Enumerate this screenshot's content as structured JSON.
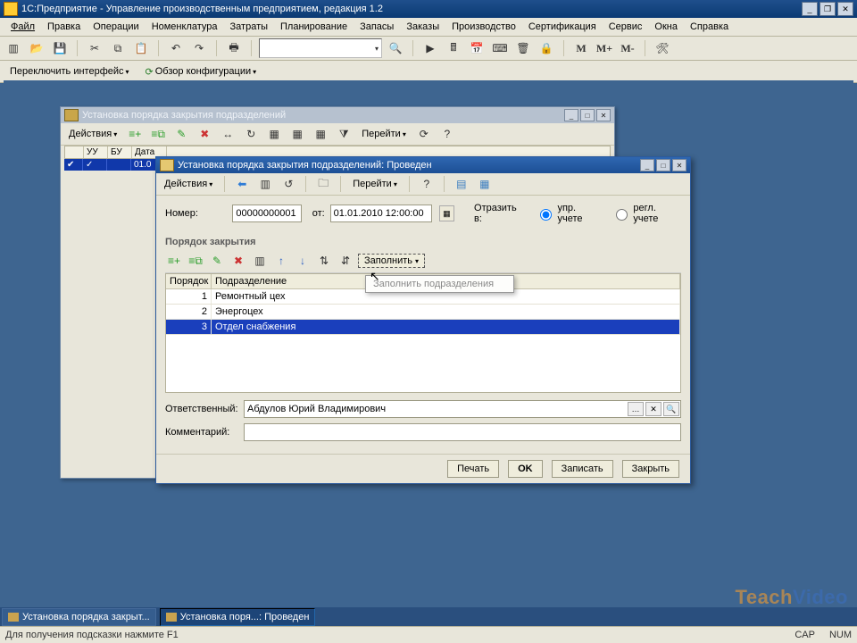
{
  "app": {
    "title": "1С:Предприятие - Управление производственным предприятием, редакция 1.2"
  },
  "menu": [
    "Файл",
    "Правка",
    "Операции",
    "Номенклатура",
    "Затраты",
    "Планирование",
    "Запасы",
    "Заказы",
    "Производство",
    "Сертификация",
    "Сервис",
    "Окна",
    "Справка"
  ],
  "subtoolbar": {
    "switch_iface": "Переключить интерфейс",
    "config_overview": "Обзор конфигурации"
  },
  "toolbar_letters": {
    "m": "M",
    "mp": "M+",
    "mm": "M-"
  },
  "bg_window": {
    "title": "Установка порядка закрытия подразделений",
    "actions": "Действия",
    "go": "Перейти",
    "headers": {
      "uu": "УУ",
      "bu": "БУ",
      "date": "Дата"
    },
    "row_date": "01.0"
  },
  "modal": {
    "title": "Установка порядка закрытия подразделений: Проведен",
    "actions": "Действия",
    "go": "Перейти",
    "number_label": "Номер:",
    "number_value": "00000000001",
    "from_label": "от:",
    "date_value": "01.01.2010 12:00:00",
    "reflect_label": "Отразить в:",
    "radio_mgmt": "упр. учете",
    "radio_reg": "регл. учете",
    "section": "Порядок закрытия",
    "fill_btn": "Заполнить",
    "menu_fill_depts": "Заполнить подразделения",
    "table": {
      "col_order": "Порядок",
      "col_dept": "Подразделение",
      "rows": [
        {
          "order": "1",
          "dept": "Ремонтный цех"
        },
        {
          "order": "2",
          "dept": "Энергоцех"
        },
        {
          "order": "3",
          "dept": "Отдел снабжения"
        }
      ]
    },
    "resp_label": "Ответственный:",
    "resp_value": "Абдулов Юрий Владимирович",
    "comment_label": "Комментарий:",
    "buttons": {
      "print": "Печать",
      "ok": "OK",
      "save": "Записать",
      "close": "Закрыть"
    }
  },
  "taskbar": {
    "task1": "Установка порядка закрыт...",
    "task2": "Установка поря...: Проведен"
  },
  "statusbar": {
    "hint": "Для получения подсказки нажмите F1",
    "cap": "CAP",
    "num": "NUM"
  },
  "watermark": {
    "a": "Teach",
    "b": "Video"
  }
}
